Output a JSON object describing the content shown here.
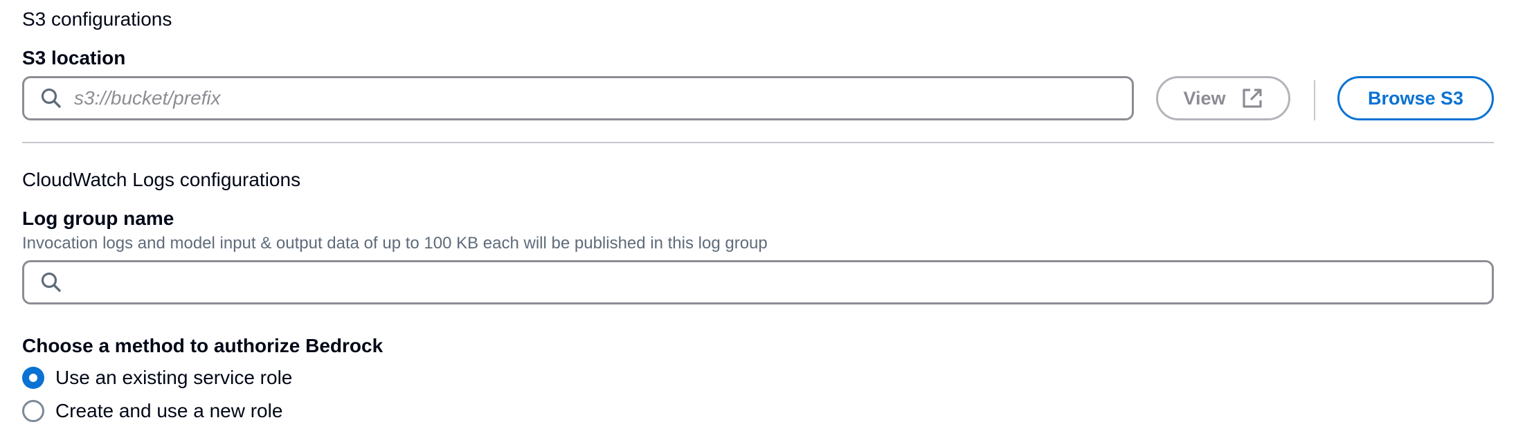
{
  "s3_section": {
    "heading": "S3 configurations",
    "location_label": "S3 location",
    "location_input": {
      "value": "",
      "placeholder": "s3://bucket/prefix",
      "icon": "search-icon"
    },
    "view_button": {
      "label": "View",
      "icon": "external-link-icon",
      "enabled": false
    },
    "browse_button": {
      "label": "Browse S3"
    }
  },
  "cloudwatch_section": {
    "heading": "CloudWatch Logs configurations",
    "log_group_label": "Log group name",
    "log_group_description": "Invocation logs and model input & output data of up to 100 KB each will be published in this log group",
    "log_group_input": {
      "value": "",
      "placeholder": "",
      "icon": "search-icon"
    }
  },
  "authorization": {
    "heading": "Choose a method to authorize Bedrock",
    "options": [
      {
        "label": "Use an existing service role",
        "selected": true
      },
      {
        "label": "Create and use a new role",
        "selected": false
      }
    ]
  },
  "colors": {
    "accent": "#0972d3",
    "border": "#8c8c94",
    "disabled": "#b4b4bb",
    "text": "#000716",
    "secondary_text": "#5f6b7a"
  }
}
